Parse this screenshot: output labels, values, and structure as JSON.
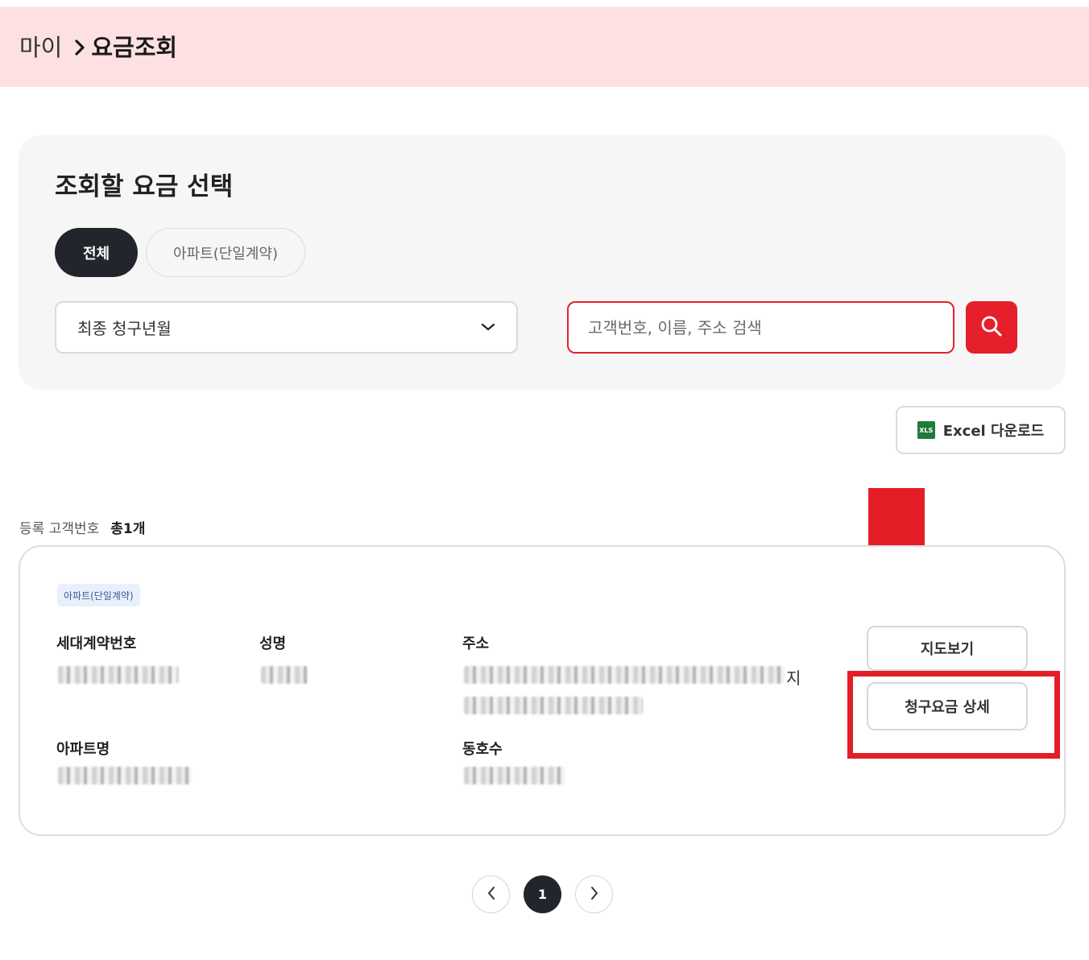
{
  "breadcrumb": {
    "parent": "마이",
    "current": "요금조회"
  },
  "filter_panel": {
    "title": "조회할 요금 선택",
    "chips": [
      {
        "label": "전체",
        "selected": true
      },
      {
        "label": "아파트(단일계약)",
        "selected": false
      }
    ],
    "period_select": {
      "value": "최종 청구년월"
    },
    "search": {
      "placeholder": "고객번호, 이름, 주소 검색",
      "value": ""
    }
  },
  "toolbar": {
    "excel_label": "Excel 다운로드",
    "xls_icon_text": "XLS"
  },
  "list": {
    "count_label": "등록 고객번호",
    "count_value": "총1개"
  },
  "card": {
    "type_tag": "아파트(단일계약)",
    "fields": {
      "contract_no_label": "세대계약번호",
      "name_label": "성명",
      "address_label": "주소",
      "address_tail": "지",
      "apartment_label": "아파트명",
      "unit_label": "동호수"
    },
    "buttons": {
      "map": "지도보기",
      "bill_detail": "청구요금 상세"
    }
  },
  "pagination": {
    "current": "1"
  },
  "colors": {
    "accent_red": "#e5202a",
    "header_bg": "#fde1e2",
    "dark_chip": "#23252c"
  }
}
